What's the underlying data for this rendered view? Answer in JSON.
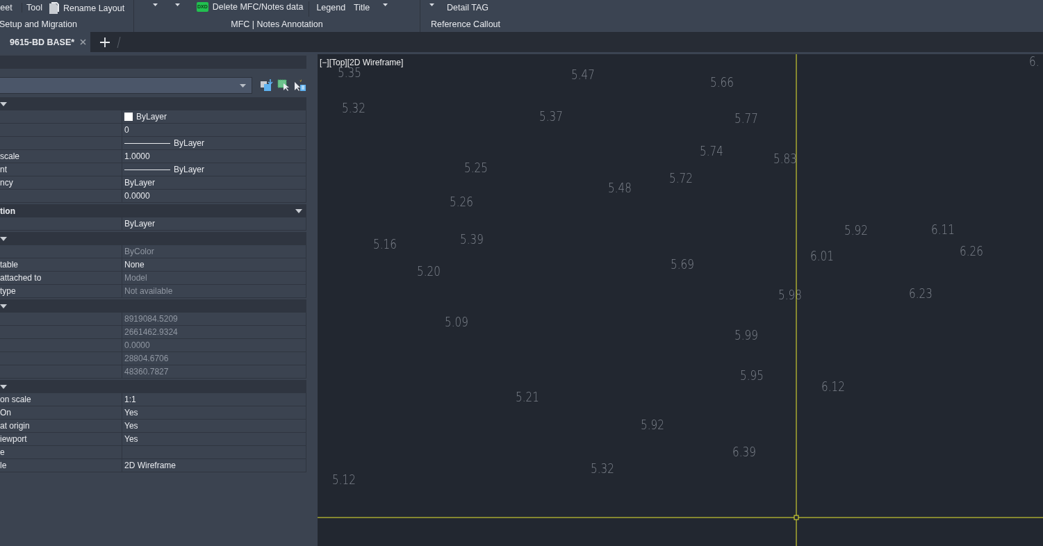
{
  "ribbon": {
    "groups": [
      {
        "label": "Setup and Migration",
        "items": [
          {
            "kind": "large",
            "label": "eet",
            "caret": false
          },
          {
            "kind": "large",
            "label": "Tool",
            "caret": false
          },
          {
            "kind": "doc",
            "label": "Rename Layout"
          }
        ]
      },
      {
        "label": "MFC | Notes Annotation",
        "items": [
          {
            "kind": "large",
            "caret": true
          },
          {
            "kind": "large",
            "caret": true
          },
          {
            "kind": "badge",
            "label": "Delete MFC/Notes data",
            "icon_text": "DXD"
          },
          {
            "kind": "sep"
          },
          {
            "kind": "large",
            "label": "Legend",
            "caret": false
          },
          {
            "kind": "large",
            "label": "Title",
            "caret": false
          },
          {
            "kind": "large",
            "caret": true
          }
        ]
      },
      {
        "label": "Reference Callout",
        "items": [
          {
            "kind": "large",
            "caret": true
          },
          {
            "kind": "large",
            "label": "Detail TAG",
            "caret": false
          }
        ]
      }
    ]
  },
  "tabs": [
    {
      "label": "9615-BD BASE*",
      "selected": true
    }
  ],
  "properties": {
    "sections": [
      {
        "rows": [
          {
            "value": "ByLayer",
            "kind": "swatch",
            "disabled": false
          },
          {
            "value": "0",
            "kind": "text",
            "disabled": false
          },
          {
            "value": "ByLayer",
            "kind": "linetype",
            "disabled": false
          },
          {
            "label": "scale",
            "value": "1.0000",
            "kind": "text",
            "disabled": false
          },
          {
            "label": "nt",
            "value": "ByLayer",
            "kind": "linetype",
            "disabled": false
          },
          {
            "label": "ncy",
            "value": "ByLayer",
            "kind": "text",
            "disabled": false
          },
          {
            "value": "0.0000",
            "kind": "text",
            "disabled": false
          }
        ]
      },
      {
        "title": "tion",
        "rows": [
          {
            "value": "ByLayer",
            "kind": "text",
            "disabled": false
          }
        ]
      },
      {
        "rows": [
          {
            "value": "ByColor",
            "kind": "text",
            "disabled": true
          },
          {
            "label": "table",
            "value": "None",
            "kind": "text",
            "disabled": false
          },
          {
            "label": "attached to",
            "value": "Model",
            "kind": "text",
            "disabled": true
          },
          {
            "label": "type",
            "value": "Not available",
            "kind": "text",
            "disabled": true
          }
        ]
      },
      {
        "rows": [
          {
            "value": "8919084.5209",
            "kind": "text",
            "disabled": true
          },
          {
            "value": "2661462.9324",
            "kind": "text",
            "disabled": true
          },
          {
            "value": "0.0000",
            "kind": "text",
            "disabled": true
          },
          {
            "value": "28804.6706",
            "kind": "text",
            "disabled": true
          },
          {
            "value": "48360.7827",
            "kind": "text",
            "disabled": true
          }
        ]
      },
      {
        "rows": [
          {
            "label": "on scale",
            "value": "1:1",
            "kind": "text",
            "disabled": false
          },
          {
            "label": "On",
            "value": "Yes",
            "kind": "text",
            "disabled": false
          },
          {
            "label": "at origin",
            "value": "Yes",
            "kind": "text",
            "disabled": false
          },
          {
            "label": "iewport",
            "value": "Yes",
            "kind": "text",
            "disabled": false
          },
          {
            "label": "e",
            "kind": "text"
          },
          {
            "label": "le",
            "value": "2D Wireframe",
            "kind": "text",
            "disabled": false
          }
        ]
      }
    ]
  },
  "viewport": {
    "title": "[−][Top][2D Wireframe]",
    "labels": [
      "5.35",
      "6.",
      "5.47",
      "5.66",
      "5.32",
      "5.37",
      "5.77",
      "5.74",
      "5.83",
      "5.25",
      "5.72",
      "5.48",
      "5.26",
      "5.92",
      "6.11",
      "5.16",
      "5.39",
      "6.26",
      "6.01",
      "5.69",
      "5.20",
      "5.98",
      "6.23",
      "5.09",
      "5.99",
      "5.95",
      "6.12",
      "5.21",
      "5.92",
      "6.39",
      "5.32",
      "5.12"
    ]
  }
}
